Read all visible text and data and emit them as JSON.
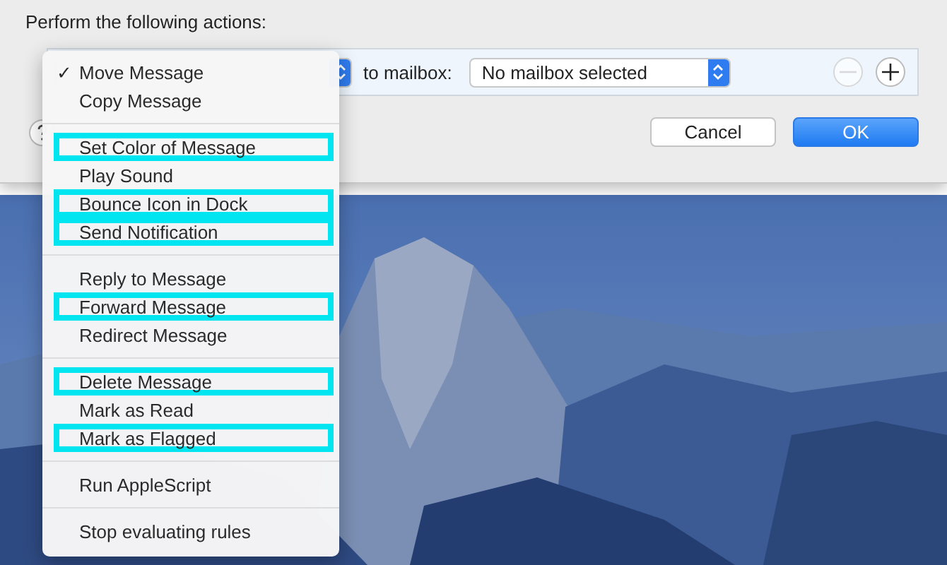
{
  "dialog": {
    "heading": "Perform the following actions:",
    "action_row": {
      "connector": "to mailbox:",
      "mailbox_popup": "No mailbox selected",
      "remove_disabled": true
    },
    "buttons": [
      {
        "label": "Cancel",
        "kind": "normal"
      },
      {
        "label": "OK",
        "kind": "default"
      }
    ]
  },
  "menu": {
    "groups": [
      {
        "items": [
          {
            "label": "Move Message",
            "checked": true,
            "highlighted": false
          },
          {
            "label": "Copy Message",
            "checked": false,
            "highlighted": false
          }
        ]
      },
      {
        "items": [
          {
            "label": "Set Color of Message",
            "checked": false,
            "highlighted": true
          },
          {
            "label": "Play Sound",
            "checked": false,
            "highlighted": false
          },
          {
            "label": "Bounce Icon in Dock",
            "checked": false,
            "highlighted": true
          },
          {
            "label": "Send Notification",
            "checked": false,
            "highlighted": true
          }
        ]
      },
      {
        "items": [
          {
            "label": "Reply to Message",
            "checked": false,
            "highlighted": false
          },
          {
            "label": "Forward Message",
            "checked": false,
            "highlighted": true
          },
          {
            "label": "Redirect Message",
            "checked": false,
            "highlighted": false
          }
        ]
      },
      {
        "items": [
          {
            "label": "Delete Message",
            "checked": false,
            "highlighted": true
          },
          {
            "label": "Mark as Read",
            "checked": false,
            "highlighted": false
          },
          {
            "label": "Mark as Flagged",
            "checked": false,
            "highlighted": true
          }
        ]
      },
      {
        "items": [
          {
            "label": "Run AppleScript",
            "checked": false,
            "highlighted": false
          }
        ]
      },
      {
        "items": [
          {
            "label": "Stop evaluating rules",
            "checked": false,
            "highlighted": false
          }
        ]
      }
    ],
    "check_mark": "✓"
  }
}
